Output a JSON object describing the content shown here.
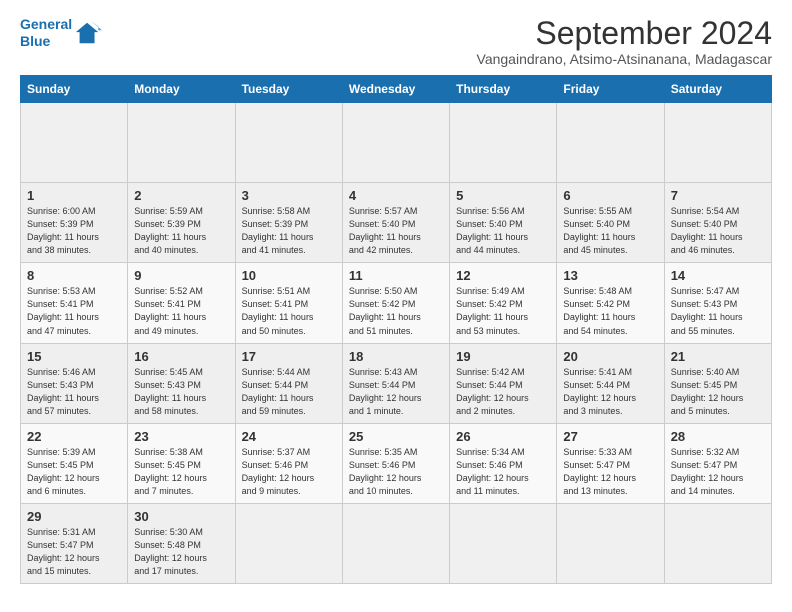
{
  "header": {
    "logo_line1": "General",
    "logo_line2": "Blue",
    "title": "September 2024",
    "subtitle": "Vangaindrano, Atsimo-Atsinanana, Madagascar"
  },
  "calendar": {
    "weekdays": [
      "Sunday",
      "Monday",
      "Tuesday",
      "Wednesday",
      "Thursday",
      "Friday",
      "Saturday"
    ],
    "weeks": [
      [
        {
          "day": "",
          "info": ""
        },
        {
          "day": "",
          "info": ""
        },
        {
          "day": "",
          "info": ""
        },
        {
          "day": "",
          "info": ""
        },
        {
          "day": "",
          "info": ""
        },
        {
          "day": "",
          "info": ""
        },
        {
          "day": "",
          "info": ""
        }
      ],
      [
        {
          "day": "1",
          "info": "Sunrise: 6:00 AM\nSunset: 5:39 PM\nDaylight: 11 hours\nand 38 minutes."
        },
        {
          "day": "2",
          "info": "Sunrise: 5:59 AM\nSunset: 5:39 PM\nDaylight: 11 hours\nand 40 minutes."
        },
        {
          "day": "3",
          "info": "Sunrise: 5:58 AM\nSunset: 5:39 PM\nDaylight: 11 hours\nand 41 minutes."
        },
        {
          "day": "4",
          "info": "Sunrise: 5:57 AM\nSunset: 5:40 PM\nDaylight: 11 hours\nand 42 minutes."
        },
        {
          "day": "5",
          "info": "Sunrise: 5:56 AM\nSunset: 5:40 PM\nDaylight: 11 hours\nand 44 minutes."
        },
        {
          "day": "6",
          "info": "Sunrise: 5:55 AM\nSunset: 5:40 PM\nDaylight: 11 hours\nand 45 minutes."
        },
        {
          "day": "7",
          "info": "Sunrise: 5:54 AM\nSunset: 5:40 PM\nDaylight: 11 hours\nand 46 minutes."
        }
      ],
      [
        {
          "day": "8",
          "info": "Sunrise: 5:53 AM\nSunset: 5:41 PM\nDaylight: 11 hours\nand 47 minutes."
        },
        {
          "day": "9",
          "info": "Sunrise: 5:52 AM\nSunset: 5:41 PM\nDaylight: 11 hours\nand 49 minutes."
        },
        {
          "day": "10",
          "info": "Sunrise: 5:51 AM\nSunset: 5:41 PM\nDaylight: 11 hours\nand 50 minutes."
        },
        {
          "day": "11",
          "info": "Sunrise: 5:50 AM\nSunset: 5:42 PM\nDaylight: 11 hours\nand 51 minutes."
        },
        {
          "day": "12",
          "info": "Sunrise: 5:49 AM\nSunset: 5:42 PM\nDaylight: 11 hours\nand 53 minutes."
        },
        {
          "day": "13",
          "info": "Sunrise: 5:48 AM\nSunset: 5:42 PM\nDaylight: 11 hours\nand 54 minutes."
        },
        {
          "day": "14",
          "info": "Sunrise: 5:47 AM\nSunset: 5:43 PM\nDaylight: 11 hours\nand 55 minutes."
        }
      ],
      [
        {
          "day": "15",
          "info": "Sunrise: 5:46 AM\nSunset: 5:43 PM\nDaylight: 11 hours\nand 57 minutes."
        },
        {
          "day": "16",
          "info": "Sunrise: 5:45 AM\nSunset: 5:43 PM\nDaylight: 11 hours\nand 58 minutes."
        },
        {
          "day": "17",
          "info": "Sunrise: 5:44 AM\nSunset: 5:44 PM\nDaylight: 11 hours\nand 59 minutes."
        },
        {
          "day": "18",
          "info": "Sunrise: 5:43 AM\nSunset: 5:44 PM\nDaylight: 12 hours\nand 1 minute."
        },
        {
          "day": "19",
          "info": "Sunrise: 5:42 AM\nSunset: 5:44 PM\nDaylight: 12 hours\nand 2 minutes."
        },
        {
          "day": "20",
          "info": "Sunrise: 5:41 AM\nSunset: 5:44 PM\nDaylight: 12 hours\nand 3 minutes."
        },
        {
          "day": "21",
          "info": "Sunrise: 5:40 AM\nSunset: 5:45 PM\nDaylight: 12 hours\nand 5 minutes."
        }
      ],
      [
        {
          "day": "22",
          "info": "Sunrise: 5:39 AM\nSunset: 5:45 PM\nDaylight: 12 hours\nand 6 minutes."
        },
        {
          "day": "23",
          "info": "Sunrise: 5:38 AM\nSunset: 5:45 PM\nDaylight: 12 hours\nand 7 minutes."
        },
        {
          "day": "24",
          "info": "Sunrise: 5:37 AM\nSunset: 5:46 PM\nDaylight: 12 hours\nand 9 minutes."
        },
        {
          "day": "25",
          "info": "Sunrise: 5:35 AM\nSunset: 5:46 PM\nDaylight: 12 hours\nand 10 minutes."
        },
        {
          "day": "26",
          "info": "Sunrise: 5:34 AM\nSunset: 5:46 PM\nDaylight: 12 hours\nand 11 minutes."
        },
        {
          "day": "27",
          "info": "Sunrise: 5:33 AM\nSunset: 5:47 PM\nDaylight: 12 hours\nand 13 minutes."
        },
        {
          "day": "28",
          "info": "Sunrise: 5:32 AM\nSunset: 5:47 PM\nDaylight: 12 hours\nand 14 minutes."
        }
      ],
      [
        {
          "day": "29",
          "info": "Sunrise: 5:31 AM\nSunset: 5:47 PM\nDaylight: 12 hours\nand 15 minutes."
        },
        {
          "day": "30",
          "info": "Sunrise: 5:30 AM\nSunset: 5:48 PM\nDaylight: 12 hours\nand 17 minutes."
        },
        {
          "day": "",
          "info": ""
        },
        {
          "day": "",
          "info": ""
        },
        {
          "day": "",
          "info": ""
        },
        {
          "day": "",
          "info": ""
        },
        {
          "day": "",
          "info": ""
        }
      ]
    ]
  }
}
